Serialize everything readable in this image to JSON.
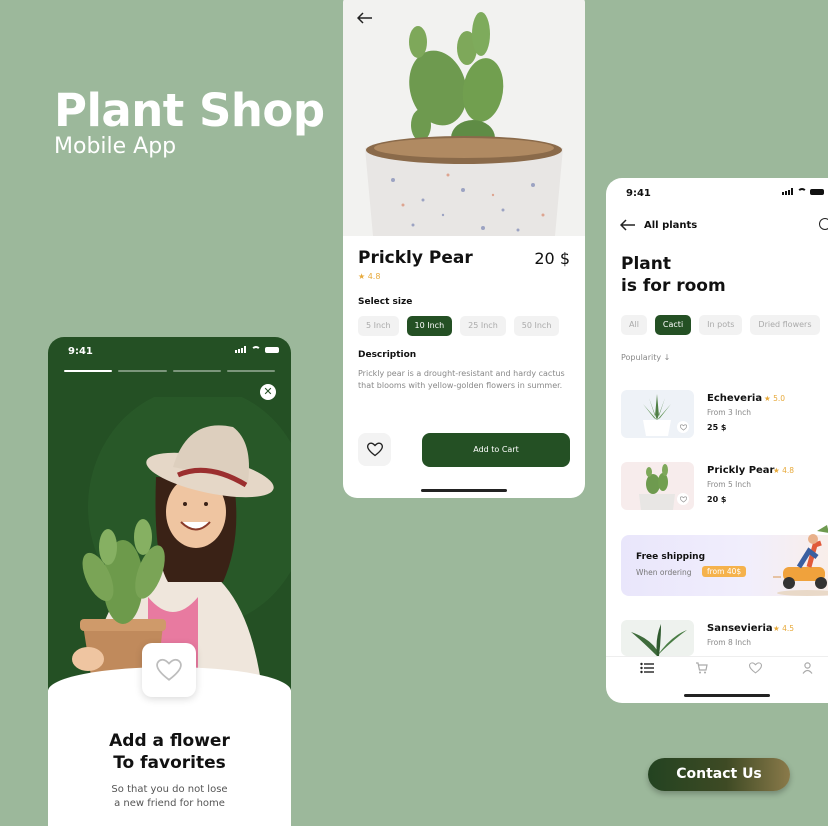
{
  "colors": {
    "background": "#9cb89b",
    "brand_green": "#245024",
    "star": "#e7a93a",
    "promo_tag": "#f5b24c"
  },
  "brand": {
    "title": "Plant Shop",
    "subtitle": "Mobile App"
  },
  "onboarding": {
    "time": "9:41",
    "progress_steps": 4,
    "progress_active": 1,
    "heading_line1": "Add a flower",
    "heading_line2": "To favorites",
    "text_line1": "So that you do not lose",
    "text_line2": "a new friend for home",
    "icons": [
      "close-icon",
      "heart-icon"
    ]
  },
  "detail": {
    "name": "Prickly Pear",
    "price": "20 $",
    "rating": "4.8",
    "select_size_label": "Select size",
    "sizes": [
      {
        "label": "5 Inch",
        "selected": false
      },
      {
        "label": "10 Inch",
        "selected": true
      },
      {
        "label": "25 Inch",
        "selected": false
      },
      {
        "label": "50 Inch",
        "selected": false
      }
    ],
    "description_label": "Description",
    "description": "Prickly pear is a drought-resistant and hardy cactus that blooms with yellow-golden flowers in summer.",
    "add_to_cart": "Add to Cart",
    "icons": [
      "back-arrow-icon",
      "heart-icon"
    ]
  },
  "catalog": {
    "time": "9:41",
    "nav_title": "All plants",
    "heading_line1": "Plant",
    "heading_line2": "is for room",
    "filters": [
      {
        "label": "All",
        "selected": false
      },
      {
        "label": "Cacti",
        "selected": true
      },
      {
        "label": "In pots",
        "selected": false
      },
      {
        "label": "Dried flowers",
        "selected": false
      }
    ],
    "sort_label": "Popularity ↓",
    "items": [
      {
        "name": "Echeveria",
        "rating": "5.0",
        "from": "From 3 Inch",
        "price": "25 $"
      },
      {
        "name": "Prickly Pear",
        "rating": "4.8",
        "from": "From 5 Inch",
        "price": "20 $"
      },
      {
        "name": "Sansevieria",
        "rating": "4.5",
        "from": "From 8 Inch",
        "price": ""
      }
    ],
    "promo": {
      "title": "Free shipping",
      "text": "When ordering",
      "tag": "from 40$"
    },
    "tabs": [
      "list-icon",
      "cart-icon",
      "heart-icon",
      "profile-icon"
    ]
  },
  "contact_button": "Contact Us"
}
